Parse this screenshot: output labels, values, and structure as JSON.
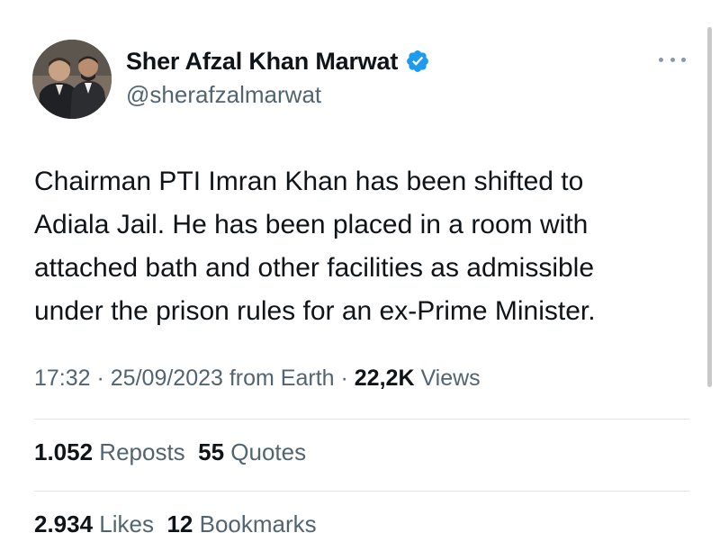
{
  "author": {
    "display_name": "Sher Afzal Khan Marwat",
    "handle": "@sherafzalmarwat",
    "verified": true
  },
  "tweet": {
    "lines": [
      "Chairman PTI Imran Khan has been shifted to",
      "Adiala Jail. He has been placed in a room with",
      "attached bath and other facilities as admissible",
      "under the prison rules for an ex-Prime Minister."
    ]
  },
  "meta": {
    "time": "17:32",
    "sep1": " · ",
    "date": "25/09/2023",
    "source": " from Earth",
    "sep2": " · ",
    "views_count": "22,2K",
    "views_label": " Views"
  },
  "stats": {
    "reposts_count": "1.052",
    "reposts_label": " Reposts",
    "quotes_count": "55",
    "quotes_label": " Quotes",
    "likes_count": "2.934",
    "likes_label": " Likes",
    "bookmarks_count": "12",
    "bookmarks_label": " Bookmarks"
  },
  "colors": {
    "text_primary": "#0f1419",
    "text_secondary": "#536471",
    "verified_badge": "#1d9bf0",
    "divider": "#e1e6ea"
  },
  "icons": {
    "verified": "verified-badge-icon",
    "more": "more-options-icon"
  }
}
